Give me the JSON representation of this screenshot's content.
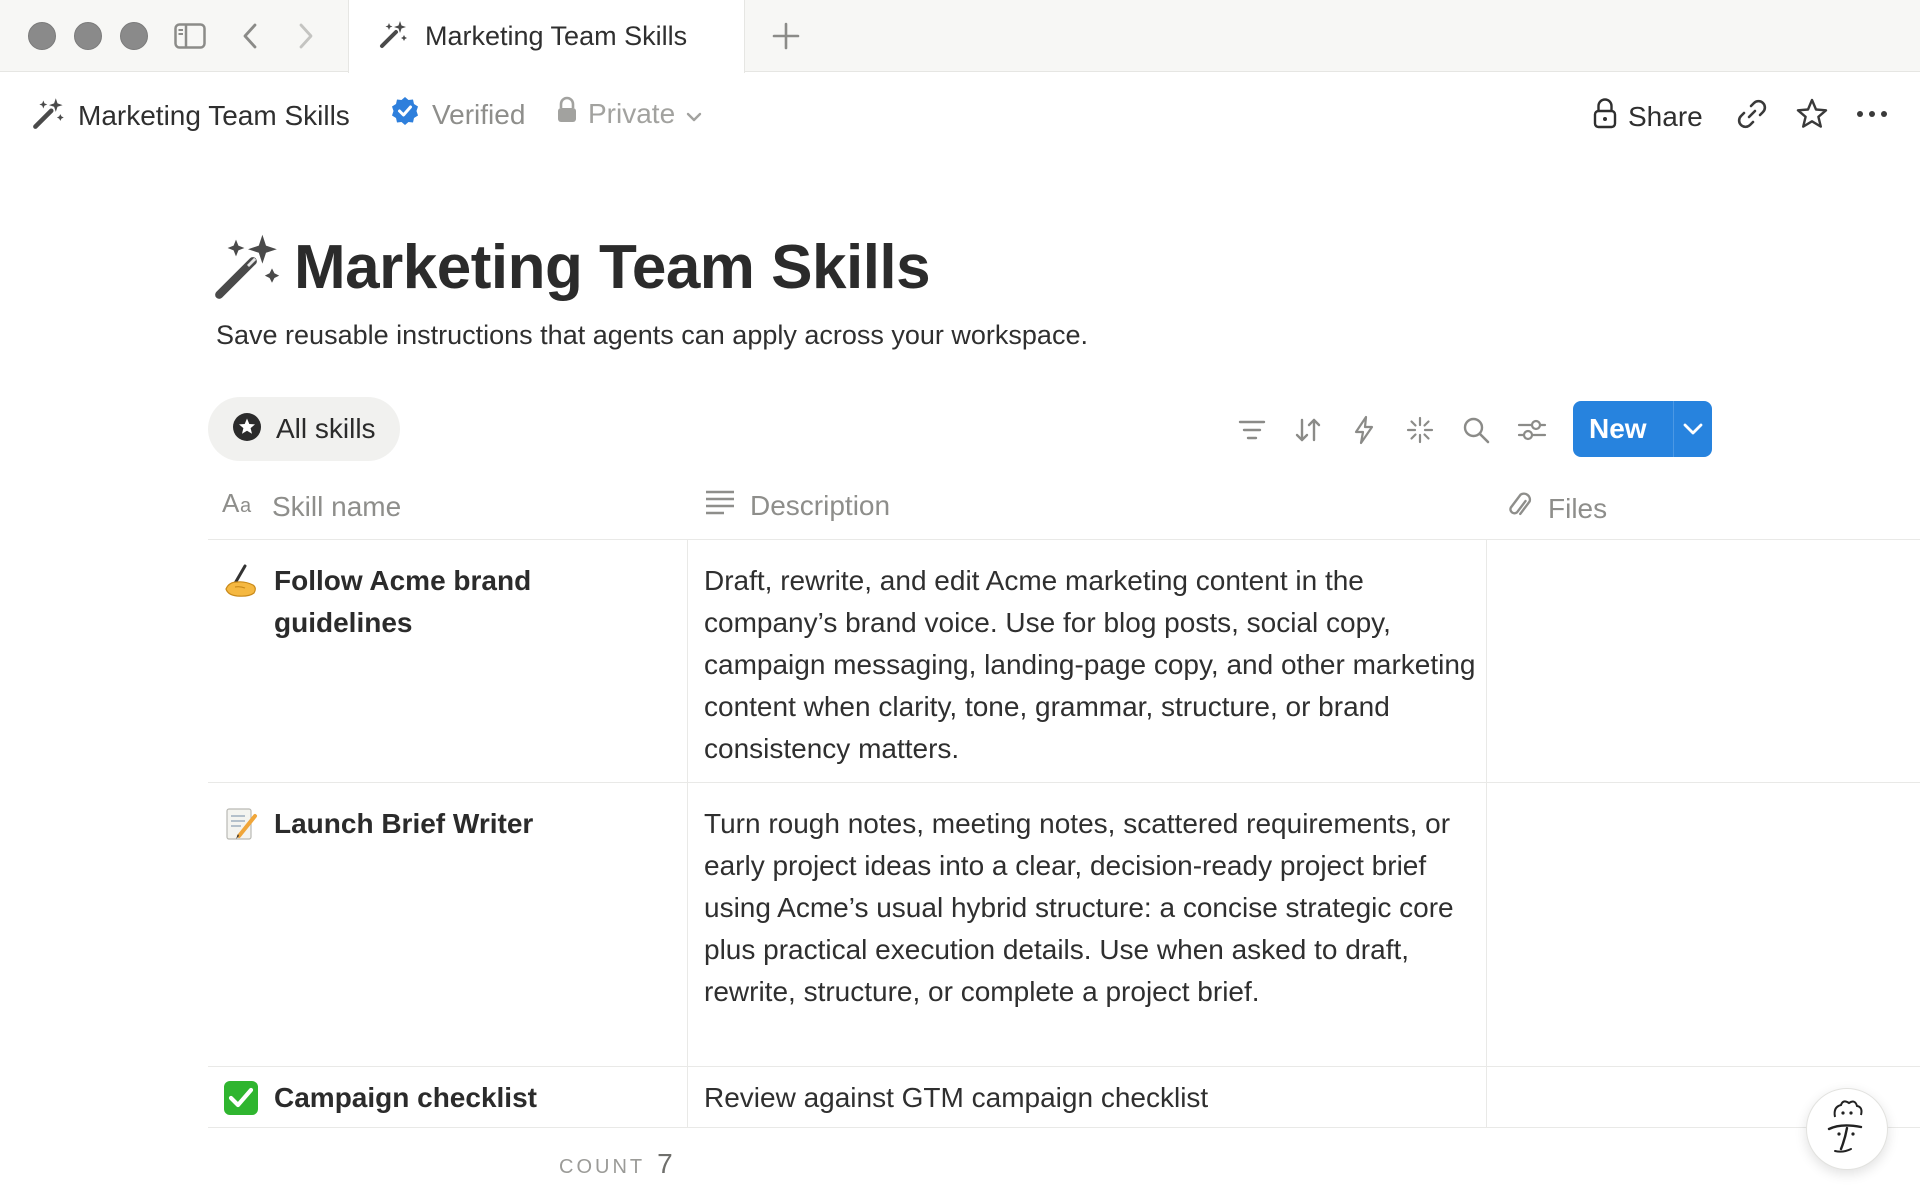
{
  "tab": {
    "title": "Marketing Team Skills",
    "icon": "magic-wand-icon"
  },
  "topbar": {
    "breadcrumb": "Marketing Team Skills",
    "verified": "Verified",
    "privacy": "Private",
    "share": "Share"
  },
  "page": {
    "title": "Marketing Team Skills",
    "description": "Save reusable instructions that agents can apply across your workspace."
  },
  "view": {
    "label": "All skills",
    "icon": "star-circle-icon"
  },
  "toolbar": {
    "icons": [
      "filter-icon",
      "sort-icon",
      "automation-icon",
      "ai-sparkle-icon",
      "search-icon",
      "settings-icon"
    ],
    "new_label": "New"
  },
  "table": {
    "columns": [
      {
        "label": "Skill name",
        "icon": "text-property-icon"
      },
      {
        "label": "Description",
        "icon": "lines-icon"
      },
      {
        "label": "Files",
        "icon": "paperclip-icon"
      }
    ],
    "rows": [
      {
        "emoji": "writing-hand-icon",
        "name": "Follow Acme brand guidelines",
        "description": "Draft, rewrite, and edit Acme marketing content in the company’s brand voice. Use for blog posts, social copy, campaign messaging, landing-page copy, and other marketing content when clarity, tone, grammar, structure, or brand consistency matters.",
        "files": ""
      },
      {
        "emoji": "memo-icon",
        "name": "Launch Brief Writer",
        "description": "Turn rough notes, meeting notes, scattered requirements, or early project ideas into a clear, decision-ready project brief using Acme’s usual hybrid structure: a concise strategic core plus practical execution details. Use when asked to draft, rewrite, structure, or complete a project brief.",
        "files": ""
      },
      {
        "emoji": "check-mark-icon",
        "name": "Campaign checklist",
        "description": "Review against GTM campaign checklist",
        "files": ""
      }
    ]
  },
  "footer": {
    "count_label": "COUNT",
    "count_value": "7"
  },
  "colors": {
    "accent": "#2783de",
    "verified": "#2e7fdc",
    "checkbox": "#2fb52f"
  }
}
